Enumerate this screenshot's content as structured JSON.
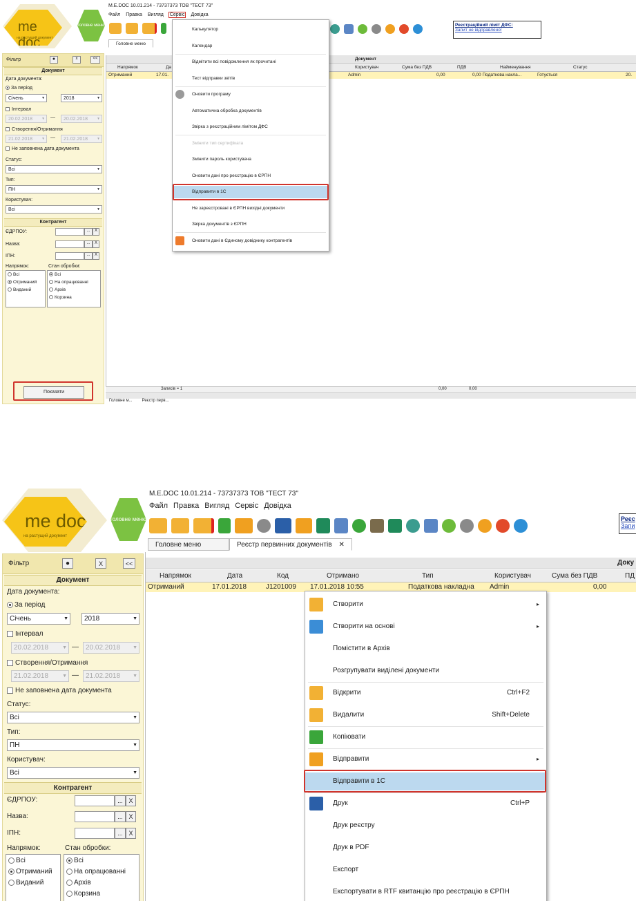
{
  "colors": {
    "logo_yellow": "#f6c417",
    "logo_green": "#7cc242",
    "filter_bg": "#fbf6d6",
    "selected_row": "#fff3b8",
    "highlight": "#bcd9ef",
    "annotation_red": "#d0342c"
  },
  "shot1": {
    "window_title": "M.E.DOC 10.01.214 - 73737373 ТОВ \"ТЕСТ 73\"",
    "menu": [
      "Файл",
      "Правка",
      "Вигляд",
      "Сервіс",
      "Довідка"
    ],
    "logo_text": "me doc",
    "logo_sub": "на растущий документ",
    "green_hex_text": "головне меню",
    "notice_title": "Реєстраційний ліміт ДФС:",
    "notice_link": "Запит не відправлено!",
    "tab_main": "Головне меню",
    "grid_title": "Документ",
    "grid_headers": [
      "Напрямок",
      "Да",
      "Користувач",
      "Сума без ПДВ",
      "ПДВ",
      "Найменування",
      "Статус"
    ],
    "grid_row": [
      "Отриманий",
      "17.01.",
      "Admin",
      "0,00",
      "0,00 Податкова накла...",
      "Готується",
      "20."
    ],
    "status_records": "Записів = 1",
    "status_sum1": "0,00",
    "status_sum2": "0,00",
    "bottom_tabs": [
      "Головне м...",
      "Реєстр перв..."
    ],
    "show_button": "Показати",
    "filter": {
      "title": "Фільтр",
      "close": "x",
      "collapse": "<<",
      "doc_section": "Документ",
      "doc_date": "Дата документа:",
      "for_period": "За період",
      "month": "Січень",
      "year": "2018",
      "interval": "Інтервал",
      "date_a": "20.02.2018",
      "date_b": "20.02.2018",
      "created": "Створення/Отримання",
      "date_c": "21.02.2018",
      "date_d": "21.02.2018",
      "no_date": "Не заповнена дата документа",
      "status_lbl": "Статус:",
      "status_val": "Всі",
      "type_lbl": "Тип:",
      "type_val": "ПН",
      "user_lbl": "Користувач:",
      "user_val": "Всі",
      "contr_section": "Контрагент",
      "edrpou": "ЄДРПОУ:",
      "name": "Назва:",
      "ipn": "ІПН:",
      "direction": "Напрямок:",
      "state": "Стан обробки:",
      "dir_opts": [
        "Всі",
        "Отриманий",
        "Виданий"
      ],
      "state_opts": [
        "Всі",
        "На опрацюванні",
        "Архів",
        "Корзина"
      ],
      "dots": "...",
      "x": "X"
    },
    "service_menu": [
      {
        "label": "Калькулятор"
      },
      {
        "label": "Календар"
      },
      {
        "label": "Відмітити всі повідомлення як прочитані"
      },
      {
        "label": "Тест відправки звітів"
      },
      {
        "label": "Оновити програму"
      },
      {
        "label": "Автоматична обробка документів"
      },
      {
        "label": "Звірка з реєстраційним лімітом ДФС"
      },
      {
        "label": "Змінити тип сертифіката"
      },
      {
        "label": "Змінити пароль користувача"
      },
      {
        "label": "Оновити дані про реєстрацію в ЄРПН"
      },
      {
        "label": "Відправити в 1С"
      },
      {
        "label": "Не зареєстровані в ЄРПН вихідні документи"
      },
      {
        "label": "Звірка документів з ЄРПН"
      },
      {
        "label": "Оновити дані в Єдиному довіднику контрагентів"
      }
    ]
  },
  "shot2": {
    "window_title": "M.E.DOC 10.01.214 - 73737373 ТОВ \"ТЕСТ 73\"",
    "menu": [
      "Файл",
      "Правка",
      "Вигляд",
      "Сервіс",
      "Довідка"
    ],
    "logo_text": "me doc",
    "logo_sub": "на растущий документ",
    "green_hex_text": "головне меню",
    "notice_title": "Реєс",
    "notice_link": "Запи",
    "tabs": [
      "Головне меню",
      "Реєстр первинних документів"
    ],
    "tab_close": "✕",
    "grid_title": "Доку",
    "grid_headers": [
      "Напрямок",
      "Дата",
      "Код",
      "Отримано",
      "Тип",
      "Користувач",
      "Сума без ПДВ",
      "ПД"
    ],
    "grid_row": [
      "Отриманий",
      "17.01.2018",
      "J1201009",
      "17.01.2018 10:55",
      "Податкова накладна",
      "Admin",
      "0,00"
    ],
    "filter": {
      "title": "Фільтр",
      "close": "X",
      "collapse": "<<",
      "doc_section": "Документ",
      "doc_date": "Дата документа:",
      "for_period": "За період",
      "month": "Січень",
      "year": "2018",
      "interval": "Інтервал",
      "date_a": "20.02.2018",
      "date_b": "20.02.2018",
      "created": "Створення/Отримання",
      "date_c": "21.02.2018",
      "date_d": "21.02.2018",
      "no_date": "Не заповнена дата документа",
      "status_lbl": "Статус:",
      "status_val": "Всі",
      "type_lbl": "Тип:",
      "type_val": "ПН",
      "user_lbl": "Користувач:",
      "user_val": "Всі",
      "contr_section": "Контрагент",
      "edrpou": "ЄДРПОУ:",
      "name": "Назва:",
      "ipn": "ІПН:",
      "direction": "Напрямок:",
      "state": "Стан обробки:",
      "dir_opts": [
        "Всі",
        "Отриманий",
        "Виданий"
      ],
      "state_opts": [
        "Всі",
        "На опрацюванні",
        "Архів",
        "Корзина"
      ],
      "dots": "...",
      "x": "X"
    },
    "context_menu": [
      {
        "label": "Створити",
        "sub": "▸"
      },
      {
        "label": "Створити на основі",
        "sub": "▸"
      },
      {
        "label": "Помістити в Архів"
      },
      {
        "label": "Розгрупувати виділені документи"
      },
      {
        "label": "Відкрити",
        "shortcut": "Ctrl+F2"
      },
      {
        "label": "Видалити",
        "shortcut": "Shift+Delete"
      },
      {
        "label": "Копіювати"
      },
      {
        "label": "Відправити",
        "sub": "▸"
      },
      {
        "label": "Відправити в 1С"
      },
      {
        "label": "Друк",
        "shortcut": "Ctrl+P"
      },
      {
        "label": "Друк реєстру"
      },
      {
        "label": "Друк в PDF"
      },
      {
        "label": "Експорт"
      },
      {
        "label": "Експортувати в RTF квитанцію про реєстрацію в ЄРПН"
      }
    ]
  }
}
